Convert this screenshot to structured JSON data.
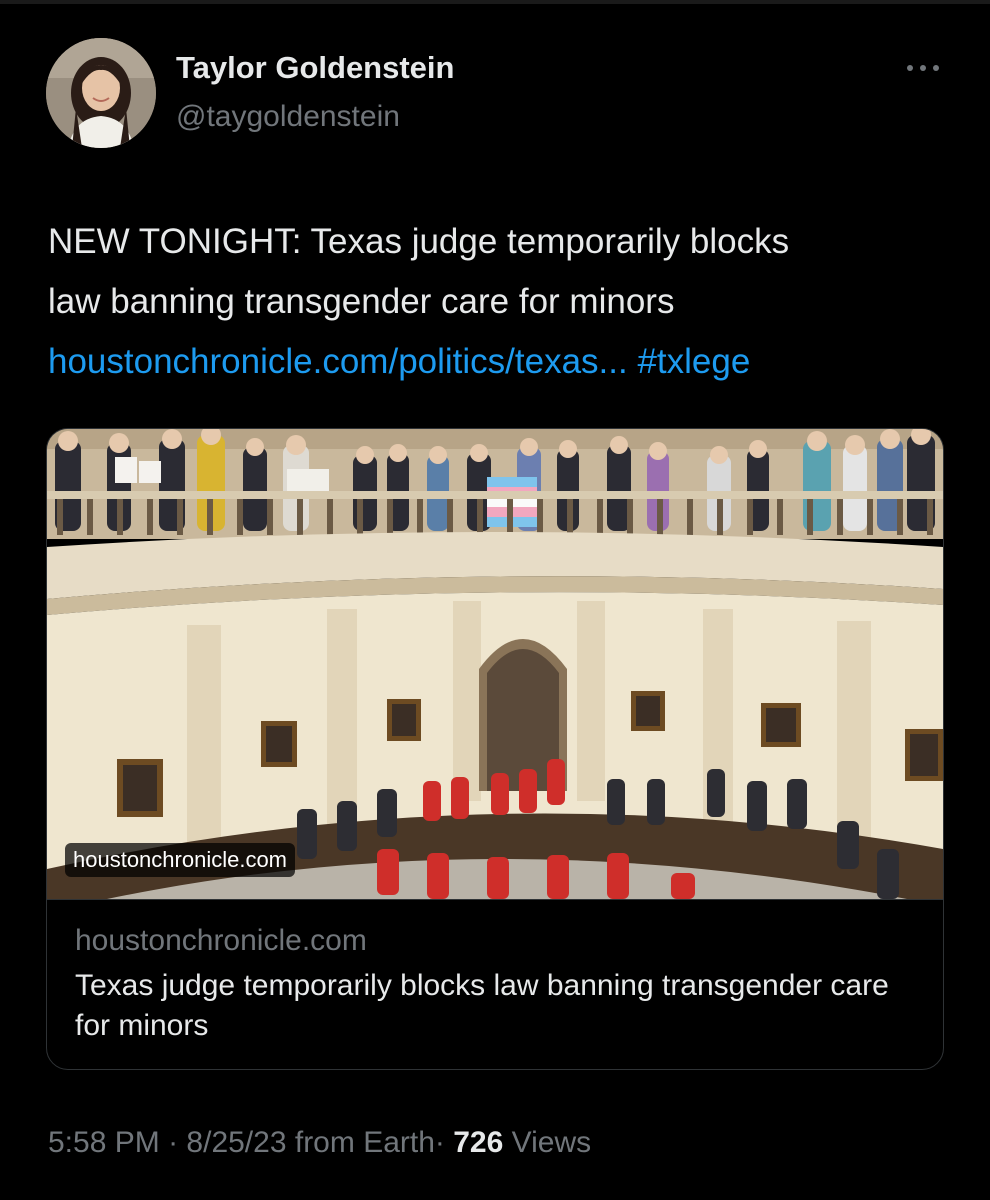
{
  "author": {
    "display_name": "Taylor Goldenstein",
    "handle": "@taygoldenstein"
  },
  "tweet": {
    "text_line1": "NEW TONIGHT: Texas judge temporarily blocks",
    "text_line2": "law banning transgender care for minors",
    "link_text": "houstonchronicle.com/politics/texas...",
    "hashtag": "#txlege"
  },
  "card": {
    "image_badge": "houstonchronicle.com",
    "domain": "houstonchronicle.com",
    "title": "Texas judge temporarily blocks law banning transgender care for minors"
  },
  "meta": {
    "time": "5:58 PM",
    "date": "8/25/23",
    "source": "from Earth",
    "separator": "·",
    "views_count": "726",
    "views_label": "Views"
  },
  "colors": {
    "background": "#000000",
    "text_primary": "#e7e9ea",
    "text_secondary": "#71767b",
    "link": "#1d9bf0",
    "border": "#2f3336"
  }
}
